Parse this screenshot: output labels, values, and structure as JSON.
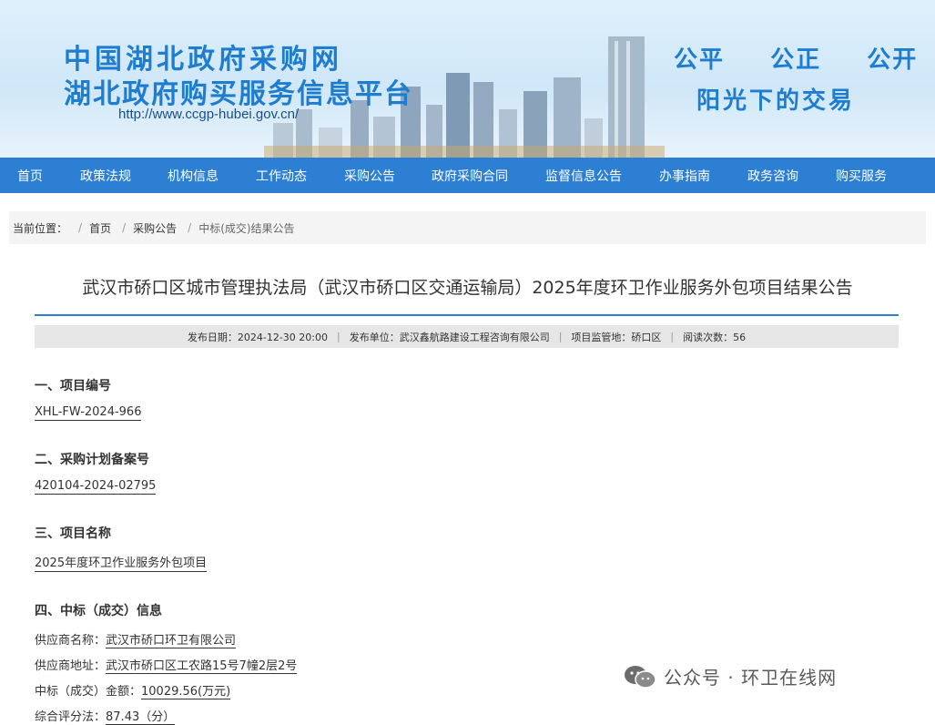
{
  "banner": {
    "title_line1": "中国湖北政府采购网",
    "title_line2": "湖北政府购买服务信息平台",
    "url": "http://www.ccgp-hubei.gov.cn/",
    "slogan_line1": "公平  公正  公开",
    "slogan_line2": "阳光下的交易"
  },
  "nav": {
    "items": [
      "首页",
      "政策法规",
      "机构信息",
      "工作动态",
      "采购公告",
      "政府采购合同",
      "监督信息公告",
      "办事指南",
      "政务咨询",
      "购买服务"
    ]
  },
  "breadcrumb": {
    "label": "当前位置：",
    "items": [
      "首页",
      "采购公告",
      "中标(成交)结果公告"
    ]
  },
  "article": {
    "title": "武汉市硚口区城市管理执法局（武汉市硚口区交通运输局）2025年度环卫作业服务外包项目结果公告",
    "meta": {
      "publish_date": "发布日期：2024-12-30 20:00",
      "publisher": "发布单位：武汉鑫航路建设工程咨询有限公司",
      "region": "项目监管地：硚口区",
      "views": "阅读次数：56"
    },
    "sections": [
      {
        "heading": "一、项目编号",
        "value": "XHL-FW-2024-966"
      },
      {
        "heading": "二、采购计划备案号",
        "value": "420104-2024-02795"
      },
      {
        "heading": "三、项目名称",
        "value": "2025年度环卫作业服务外包项目"
      }
    ],
    "award": {
      "heading": "四、中标（成交）信息",
      "rows": [
        {
          "key": "供应商名称：",
          "value": "武汉市硚口环卫有限公司"
        },
        {
          "key": "供应商地址：",
          "value": "武汉市硚口区工农路15号7幢2层2号"
        },
        {
          "key": "中标（成交）金额：",
          "value": "10029.56(万元)"
        },
        {
          "key": "综合评分法：",
          "value": "87.43（分）"
        }
      ]
    }
  },
  "watermark": "公众号 · 环卫在线网",
  "colors": {
    "accent": "#2d7fd3",
    "title_blue": "#1f7dd0"
  }
}
